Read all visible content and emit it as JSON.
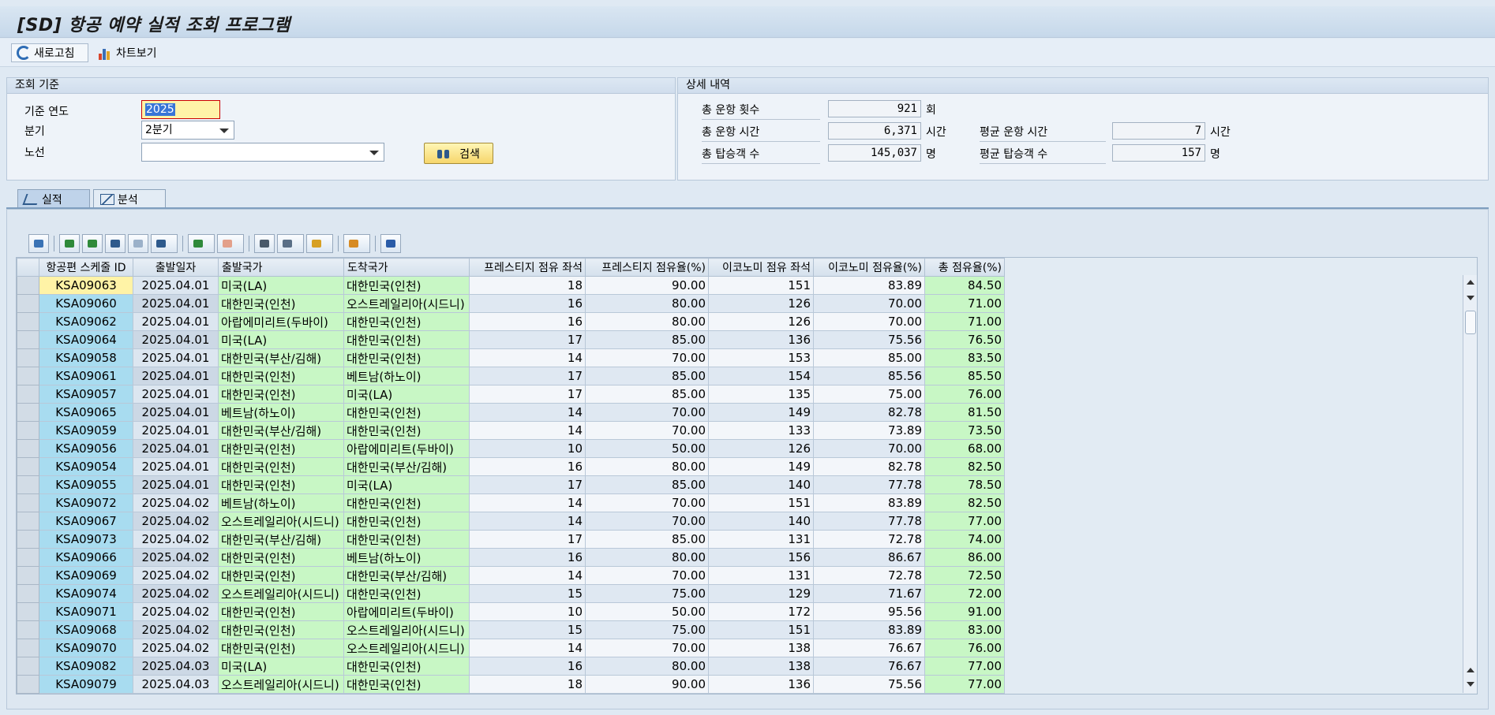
{
  "window": {
    "title": "[SD] 항공 예약 실적 조회 프로그램"
  },
  "toolbar": {
    "refresh_label": "새로고침",
    "chart_label": "차트보기"
  },
  "criteria": {
    "header": "조회 기준",
    "year_label": "기준 연도",
    "year_value": "2025",
    "quarter_label": "분기",
    "quarter_value": "2분기",
    "route_label": "노선",
    "route_value": "",
    "search_label": "검색"
  },
  "detail": {
    "header": "상세 내역",
    "total_flights_label": "총 운항 횟수",
    "total_flights_value": "921",
    "total_flights_unit": "회",
    "total_hours_label": "총 운항 시간",
    "total_hours_value": "6,371",
    "total_hours_unit": "시간",
    "avg_hours_label": "평균 운항 시간",
    "avg_hours_value": "7",
    "avg_hours_unit": "시간",
    "total_pax_label": "총 탑승객 수",
    "total_pax_value": "145,037",
    "total_pax_unit": "명",
    "avg_pax_label": "평균 탑승객 수",
    "avg_pax_value": "157",
    "avg_pax_unit": "명"
  },
  "tabs": [
    {
      "label": "실적",
      "active": true
    },
    {
      "label": "분석",
      "active": false
    }
  ],
  "grid": {
    "columns": [
      "항공편 스케줄 ID",
      "출발일자",
      "출발국가",
      "도착국가",
      "프레스티지 점유 좌석",
      "프레스티지 점유율(%)",
      "이코노미 점유 좌석",
      "이코노미 점유율(%)",
      "총 점유율(%)"
    ],
    "rows": [
      [
        "KSA09063",
        "2025.04.01",
        "미국(LA)",
        "대한민국(인천)",
        "18",
        "90.00",
        "151",
        "83.89",
        "84.50"
      ],
      [
        "KSA09060",
        "2025.04.01",
        "대한민국(인천)",
        "오스트레일리아(시드니)",
        "16",
        "80.00",
        "126",
        "70.00",
        "71.00"
      ],
      [
        "KSA09062",
        "2025.04.01",
        "아랍에미리트(두바이)",
        "대한민국(인천)",
        "16",
        "80.00",
        "126",
        "70.00",
        "71.00"
      ],
      [
        "KSA09064",
        "2025.04.01",
        "미국(LA)",
        "대한민국(인천)",
        "17",
        "85.00",
        "136",
        "75.56",
        "76.50"
      ],
      [
        "KSA09058",
        "2025.04.01",
        "대한민국(부산/김해)",
        "대한민국(인천)",
        "14",
        "70.00",
        "153",
        "85.00",
        "83.50"
      ],
      [
        "KSA09061",
        "2025.04.01",
        "대한민국(인천)",
        "베트남(하노이)",
        "17",
        "85.00",
        "154",
        "85.56",
        "85.50"
      ],
      [
        "KSA09057",
        "2025.04.01",
        "대한민국(인천)",
        "미국(LA)",
        "17",
        "85.00",
        "135",
        "75.00",
        "76.00"
      ],
      [
        "KSA09065",
        "2025.04.01",
        "베트남(하노이)",
        "대한민국(인천)",
        "14",
        "70.00",
        "149",
        "82.78",
        "81.50"
      ],
      [
        "KSA09059",
        "2025.04.01",
        "대한민국(부산/김해)",
        "대한민국(인천)",
        "14",
        "70.00",
        "133",
        "73.89",
        "73.50"
      ],
      [
        "KSA09056",
        "2025.04.01",
        "대한민국(인천)",
        "아랍에미리트(두바이)",
        "10",
        "50.00",
        "126",
        "70.00",
        "68.00"
      ],
      [
        "KSA09054",
        "2025.04.01",
        "대한민국(인천)",
        "대한민국(부산/김해)",
        "16",
        "80.00",
        "149",
        "82.78",
        "82.50"
      ],
      [
        "KSA09055",
        "2025.04.01",
        "대한민국(인천)",
        "미국(LA)",
        "17",
        "85.00",
        "140",
        "77.78",
        "78.50"
      ],
      [
        "KSA09072",
        "2025.04.02",
        "베트남(하노이)",
        "대한민국(인천)",
        "14",
        "70.00",
        "151",
        "83.89",
        "82.50"
      ],
      [
        "KSA09067",
        "2025.04.02",
        "오스트레일리아(시드니)",
        "대한민국(인천)",
        "14",
        "70.00",
        "140",
        "77.78",
        "77.00"
      ],
      [
        "KSA09073",
        "2025.04.02",
        "대한민국(부산/김해)",
        "대한민국(인천)",
        "17",
        "85.00",
        "131",
        "72.78",
        "74.00"
      ],
      [
        "KSA09066",
        "2025.04.02",
        "대한민국(인천)",
        "베트남(하노이)",
        "16",
        "80.00",
        "156",
        "86.67",
        "86.00"
      ],
      [
        "KSA09069",
        "2025.04.02",
        "대한민국(인천)",
        "대한민국(부산/김해)",
        "14",
        "70.00",
        "131",
        "72.78",
        "72.50"
      ],
      [
        "KSA09074",
        "2025.04.02",
        "오스트레일리아(시드니)",
        "대한민국(인천)",
        "15",
        "75.00",
        "129",
        "71.67",
        "72.00"
      ],
      [
        "KSA09071",
        "2025.04.02",
        "대한민국(인천)",
        "아랍에미리트(두바이)",
        "10",
        "50.00",
        "172",
        "95.56",
        "91.00"
      ],
      [
        "KSA09068",
        "2025.04.02",
        "대한민국(인천)",
        "오스트레일리아(시드니)",
        "15",
        "75.00",
        "151",
        "83.89",
        "83.00"
      ],
      [
        "KSA09070",
        "2025.04.02",
        "대한민국(인천)",
        "오스트레일리아(시드니)",
        "14",
        "70.00",
        "138",
        "76.67",
        "76.00"
      ],
      [
        "KSA09082",
        "2025.04.03",
        "미국(LA)",
        "대한민국(인천)",
        "16",
        "80.00",
        "138",
        "76.67",
        "77.00"
      ],
      [
        "KSA09079",
        "2025.04.03",
        "오스트레일리아(시드니)",
        "대한민국(인천)",
        "18",
        "90.00",
        "136",
        "75.56",
        "77.00"
      ]
    ]
  }
}
